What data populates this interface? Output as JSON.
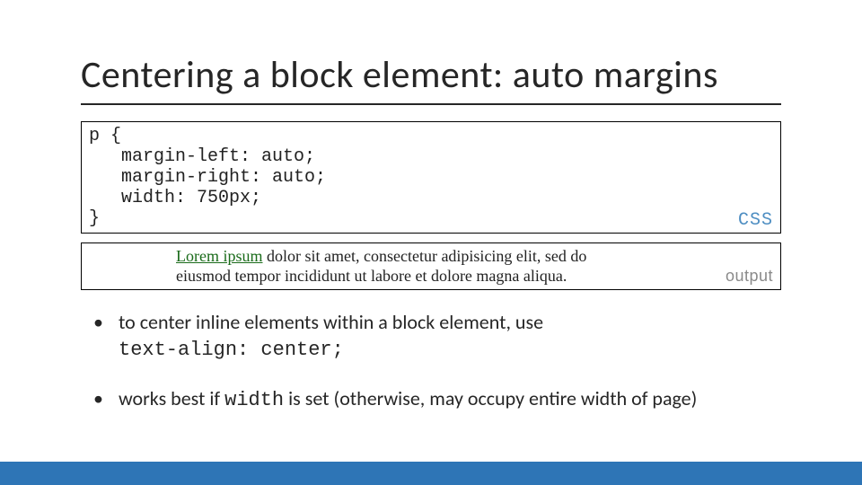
{
  "title": "Centering a block element: auto margins",
  "code": {
    "lines": "p {\n   margin-left: auto;\n   margin-right: auto;\n   width: 750px;\n}",
    "label": "CSS"
  },
  "output": {
    "link_text": "Lorem ipsum",
    "rest": " dolor sit amet, consectetur adipisicing elit, sed do eiusmod tempor incididunt ut labore et dolore magna aliqua.",
    "label": "output"
  },
  "bullets": {
    "b1_pre": "to center inline elements within a block element, use ",
    "b1_code": "text-align: center;",
    "b2_pre": "works best if ",
    "b2_code": "width",
    "b2_post": " is set (otherwise, may occupy entire width of page)"
  }
}
